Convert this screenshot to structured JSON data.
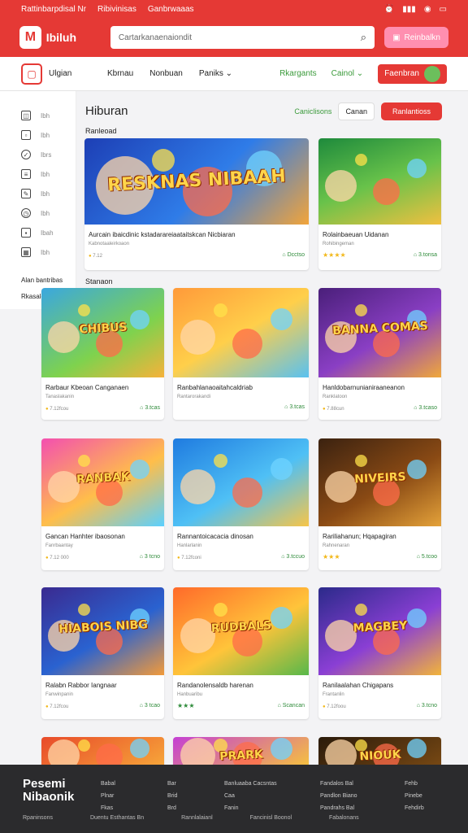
{
  "status": {
    "left_a": "Rattinbarpdisal Nr",
    "left_b": "Ribivinisas",
    "left_c": "Ganbrwaaas",
    "icons": [
      "alarm-icon",
      "signal-icon",
      "wifi-icon",
      "battery-icon"
    ]
  },
  "header": {
    "logo_glyph": "M",
    "brand": "Ibiluh",
    "search_placeholder": "Cartarkanaenaiondit",
    "login_label": "Reinbalkn"
  },
  "nav": {
    "brand": "Ulgian",
    "links": [
      "Kbrnau",
      "Nonbuan",
      "Paniks"
    ],
    "right_a": "Rkargants",
    "right_b": "Cainol",
    "play_label": "Faenbran"
  },
  "sidebar": {
    "items": [
      "Ibh",
      "Ibh",
      "Ibrs",
      "Ibh",
      "Ibh",
      "Ibh",
      "Ibah",
      "Ibh"
    ],
    "foot_a": "Alan bantribas",
    "foot_b": "Rkasaleiaaiaan"
  },
  "main": {
    "title": "Hiburan",
    "filters": {
      "a": "Caniclisons",
      "b": "Canan",
      "c": "Ranlantioss"
    },
    "section1": "Ranleoad",
    "section2": "Stanaon"
  },
  "games": [
    {
      "thumb_title": "RESKNAS NIBAAH",
      "title": "Aurcain ibaicdinic kstadarareiaataitskcan Nicbiaran",
      "sub": "Kabnotaaleirkoaon",
      "rating": "7.12",
      "stars": "",
      "stat": "Dcctso"
    },
    {
      "thumb_title": "",
      "title": "Rolainbaeuan Uidanan",
      "sub": "Rohibingeman",
      "rating": "",
      "stars": "★★★★",
      "stat": "3.tonsa"
    },
    {
      "thumb_title": "CHIBUS",
      "title": "Rarbaur Kbeoan Canganaen",
      "sub": "Tanaslakanin",
      "rating": "7.12fcou",
      "stars": "",
      "stat": "3.tcas"
    },
    {
      "thumb_title": "",
      "title": "Ranbahlanaoaitahcaldriab",
      "sub": "Rantarorakandi",
      "rating": "",
      "stars": "",
      "stat": "3.tcas"
    },
    {
      "thumb_title": "BANNA COMAS",
      "title": "Hanldobarnunianiraaneanon",
      "sub": "Ranklatoon",
      "rating": "7.88cun",
      "stars": "",
      "stat": "3.tcaso"
    },
    {
      "thumb_title": "RANBAK",
      "title": "Gancan Hanhter ibaosonan",
      "sub": "Fanrbaantay",
      "rating": "7.12 000",
      "stars": "",
      "stat": "3 tcno"
    },
    {
      "thumb_title": "",
      "title": "Rannantoicacacia dinosan",
      "sub": "Hanlarlanin",
      "rating": "7.12fconi",
      "stars": "",
      "stat": "3.tccuo"
    },
    {
      "thumb_title": "NIVEIRS",
      "title": "Rariliahanun; Hqapagiran",
      "sub": "Rahnenaran",
      "rating": "",
      "stars": "★★★",
      "stat": "5.tcoo"
    },
    {
      "thumb_title": "HIABOIS NIBG",
      "title": "Ralabn Rabbor Iangnaar",
      "sub": "Fanwinpanin",
      "rating": "7.12fcou",
      "stars": "",
      "stat": "3 tcao"
    },
    {
      "thumb_title": "RUDBALS",
      "title": "Randanolensaldb harenan",
      "sub": "Hanbuaribu",
      "rating": "",
      "stars": "★★★",
      "stat": "Scancan"
    },
    {
      "thumb_title": "MAGBEY",
      "title": "Ranilaalahan Chigapans",
      "sub": "Frantanlin",
      "rating": "7.12foou",
      "stars": "",
      "stat": "3.tcno"
    },
    {
      "thumb_title": "",
      "title": "",
      "sub": "",
      "rating": "",
      "stars": "",
      "stat": ""
    },
    {
      "thumb_title": "PRARK",
      "title": "",
      "sub": "",
      "rating": "",
      "stars": "",
      "stat": ""
    },
    {
      "thumb_title": "NIOUK",
      "title": "",
      "sub": "",
      "rating": "",
      "stars": "",
      "stat": ""
    }
  ],
  "footer": {
    "brand_a": "Pesemi",
    "brand_b": "Nibaonik",
    "col1": [
      "Babal",
      "Plnar",
      "Fkas"
    ],
    "col2": [
      "Bar",
      "Brid",
      "Brd"
    ],
    "col3": [
      "Banluaaba Cacsntas",
      "Caa",
      "Fanin"
    ],
    "col4": [
      "Fandalos Bal",
      "Pandlon Biano",
      "Pandrahs Bal"
    ],
    "col5": [
      "Fehb",
      "Pinebe",
      "Fehdirb"
    ],
    "bottom": [
      "Rpaninsons",
      "Duentu Esthantas Bn",
      "Rannlalaianl",
      "Fancinisl Boonol",
      "Fabalonans"
    ]
  },
  "colors": {
    "accent": "#e53935",
    "green": "#3a9a3a",
    "footer": "#2b2b2d"
  }
}
